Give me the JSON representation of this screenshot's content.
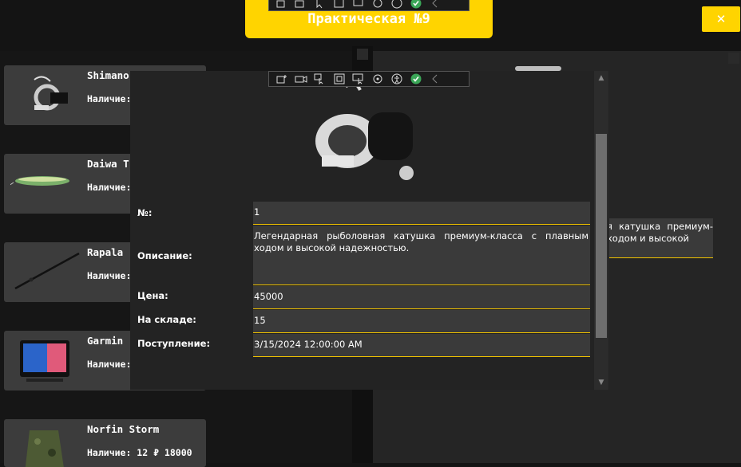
{
  "window": {
    "title": "Практическая №9",
    "close_label": "✕"
  },
  "products": [
    {
      "name": "Shimano",
      "stock_text": "Наличие:"
    },
    {
      "name": "Daiwa T",
      "stock_text": "Наличие:"
    },
    {
      "name": "Rapala",
      "stock_text": "Наличие:"
    },
    {
      "name": "Garmin",
      "stock_text": "Наличие:"
    },
    {
      "name": "Norfin Storm",
      "stock_text": "Наличие:  12 ₽ 18000"
    }
  ],
  "detail": {
    "labels": {
      "id": "№:",
      "description": "Описание:",
      "price": "Цена:",
      "stock": "На складе:",
      "arrival": "Поступление:"
    },
    "values": {
      "id": "1",
      "description": "Легендарная рыболовная катушка премиум-класса с плавным ходом и высокой надежностью.",
      "price": "45000",
      "stock": "15",
      "arrival": "3/15/2024 12:00:00 AM"
    }
  },
  "background_description": "я катушка премиум- ходом и высокой",
  "colors": {
    "accent": "#ffd400",
    "card": "#3c3c3c",
    "field_border": "#f0c200"
  },
  "toolbar_icons": [
    "grip-icon",
    "select-element-icon",
    "video-icon",
    "cursor-icon",
    "frame-icon",
    "inspect-icon",
    "hot-reload-icon",
    "accessibility-icon",
    "check-icon",
    "collapse-icon"
  ]
}
